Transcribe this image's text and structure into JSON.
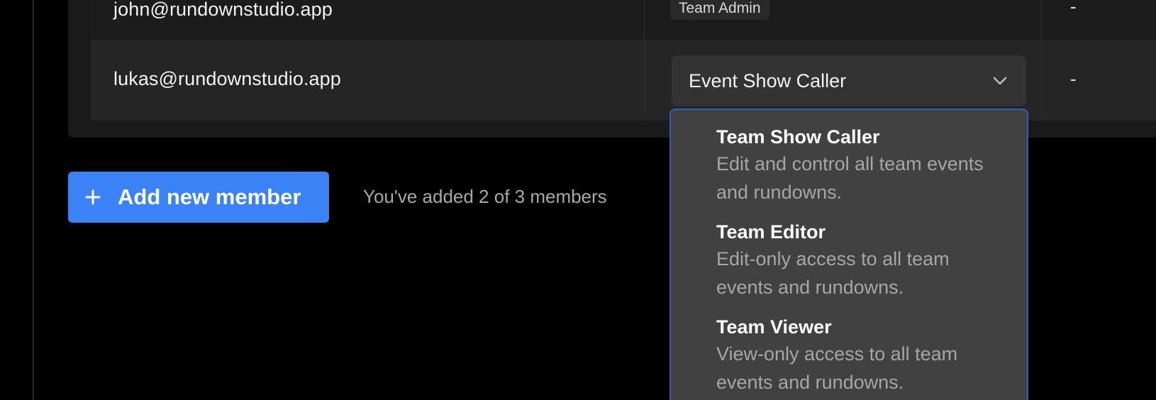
{
  "members": [
    {
      "email": "john@rundownstudio.app",
      "role": "Team Admin",
      "extra": "-"
    },
    {
      "email": "lukas@rundownstudio.app",
      "role": "Event Show Caller",
      "extra": "-"
    }
  ],
  "role_dropdown": {
    "options": [
      {
        "title": "Team Show Caller",
        "description": "Edit and control all team events and rundowns."
      },
      {
        "title": "Team Editor",
        "description": "Edit-only access to all team events and rundowns."
      },
      {
        "title": "Team Viewer",
        "description": "View-only access to all team events and rundowns."
      }
    ]
  },
  "footer": {
    "add_button_label": "Add new member",
    "member_count_text": "You've added 2 of 3 members"
  },
  "colors": {
    "accent": "#3b82f6",
    "focus_border": "#2f5fb8"
  },
  "icons": {
    "add": "plus-icon",
    "select": "chevron-down-icon"
  }
}
